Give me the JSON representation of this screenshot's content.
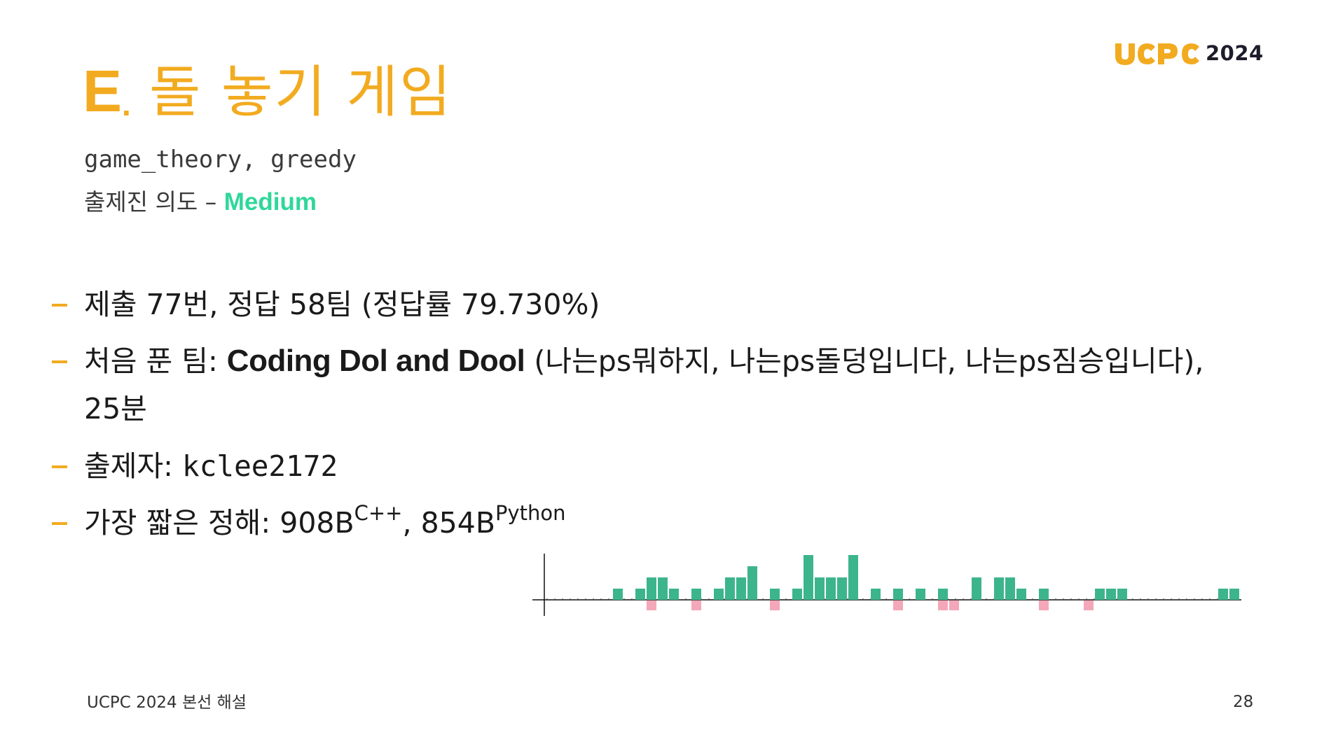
{
  "slide": {
    "title_letter": "E",
    "title_dot": ".",
    "title_name": "돌 놓기 게임",
    "logo_year": "2024",
    "tags": "game_theory, greedy",
    "intent_label": "출제진 의도 – ",
    "intent_level": "Medium",
    "footer": "UCPC 2024 본선 해설",
    "page_number": "28"
  },
  "colors": {
    "accent": "#f2ab20",
    "medium": "#2fd79a",
    "logo_text": "#1d1d2b",
    "accepted": "#3db58c",
    "rejected": "#f4a7b9"
  },
  "bullets": {
    "b1": "제출 77번, 정답 58팀 (정답률 79.730%)",
    "b2_prefix": "처음 푼 팀: ",
    "b2_team": "Coding Dol and Dool",
    "b2_members": " (나는ps뭐하지, 나는ps돌덩입니다, 나는ps짐승입니다),",
    "b2_time": "25분",
    "b3_prefix": "출제자: ",
    "b3_author": "kclee2172",
    "b4_prefix": "가장 짧은 정해: ",
    "b4_cpp_size": "908B",
    "b4_cpp_lang": "C++",
    "b4_sep": ", ",
    "b4_py_size": "854B",
    "b4_py_lang": "Python"
  },
  "chart_data": {
    "type": "bar",
    "series": [
      {
        "values": [
          0,
          0,
          0,
          0,
          0,
          0,
          1,
          0,
          1,
          2,
          2,
          1,
          0,
          1,
          0,
          1,
          2,
          2,
          3,
          0,
          1,
          0,
          1,
          4,
          2,
          2,
          2,
          4,
          0,
          1,
          0,
          1,
          0,
          1,
          0,
          1,
          0,
          0,
          2,
          0,
          2,
          2,
          1,
          0,
          1,
          0,
          0,
          0,
          0,
          1,
          1,
          1,
          0,
          0,
          0,
          0,
          0,
          0,
          0,
          0,
          1,
          1
        ]
      },
      {
        "values": [
          0,
          0,
          0,
          0,
          0,
          0,
          0,
          0,
          0,
          1,
          0,
          0,
          0,
          1,
          0,
          0,
          0,
          0,
          0,
          0,
          1,
          0,
          0,
          0,
          0,
          0,
          0,
          0,
          0,
          0,
          0,
          1,
          0,
          0,
          0,
          1,
          1,
          0,
          0,
          0,
          0,
          0,
          0,
          0,
          1,
          0,
          0,
          0,
          1,
          0,
          0,
          0,
          0,
          0,
          0,
          0,
          0,
          0,
          0,
          0,
          0,
          0
        ]
      }
    ],
    "y_max": 4,
    "grid": false
  }
}
